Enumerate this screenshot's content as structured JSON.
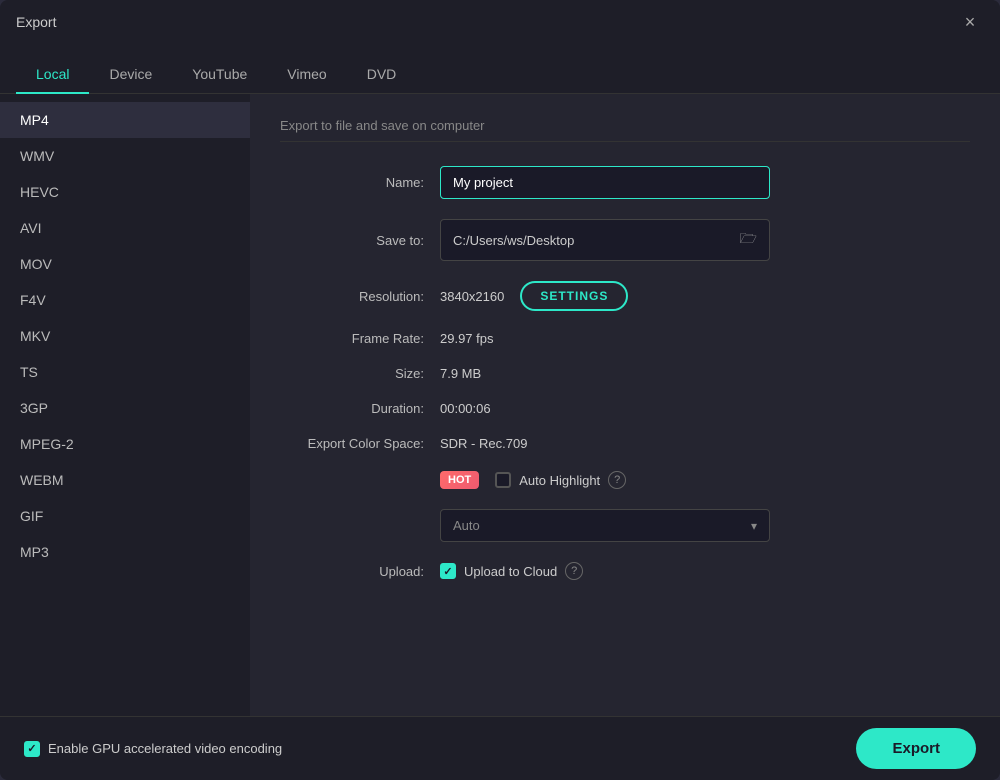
{
  "window": {
    "title": "Export",
    "close_label": "×"
  },
  "tabs": [
    {
      "label": "Local",
      "active": true
    },
    {
      "label": "Device"
    },
    {
      "label": "YouTube"
    },
    {
      "label": "Vimeo"
    },
    {
      "label": "DVD"
    }
  ],
  "sidebar": {
    "items": [
      {
        "label": "MP4",
        "active": true
      },
      {
        "label": "WMV"
      },
      {
        "label": "HEVC"
      },
      {
        "label": "AVI"
      },
      {
        "label": "MOV"
      },
      {
        "label": "F4V"
      },
      {
        "label": "MKV"
      },
      {
        "label": "TS"
      },
      {
        "label": "3GP"
      },
      {
        "label": "MPEG-2"
      },
      {
        "label": "WEBM"
      },
      {
        "label": "GIF"
      },
      {
        "label": "MP3"
      }
    ]
  },
  "main": {
    "section_title": "Export to file and save on computer",
    "name_label": "Name:",
    "name_value": "My project",
    "save_to_label": "Save to:",
    "save_to_path": "C:/Users/ws/Desktop",
    "resolution_label": "Resolution:",
    "resolution_value": "3840x2160",
    "settings_btn_label": "SETTINGS",
    "frame_rate_label": "Frame Rate:",
    "frame_rate_value": "29.97 fps",
    "size_label": "Size:",
    "size_value": "7.9 MB",
    "duration_label": "Duration:",
    "duration_value": "00:00:06",
    "export_color_label": "Export Color Space:",
    "export_color_value": "SDR - Rec.709",
    "hot_badge": "HOT",
    "auto_highlight_label": "Auto Highlight",
    "auto_highlight_checked": false,
    "auto_highlight_help": "?",
    "auto_dropdown_value": "Auto",
    "upload_label": "Upload:",
    "upload_to_cloud_label": "Upload to Cloud",
    "upload_to_cloud_checked": true,
    "upload_help": "?"
  },
  "bottom": {
    "gpu_label": "Enable GPU accelerated video encoding",
    "gpu_checked": true,
    "export_btn": "Export"
  },
  "colors": {
    "accent": "#2de8c8",
    "hot_from": "#ff6b6b",
    "hot_to": "#ee5a6f"
  }
}
